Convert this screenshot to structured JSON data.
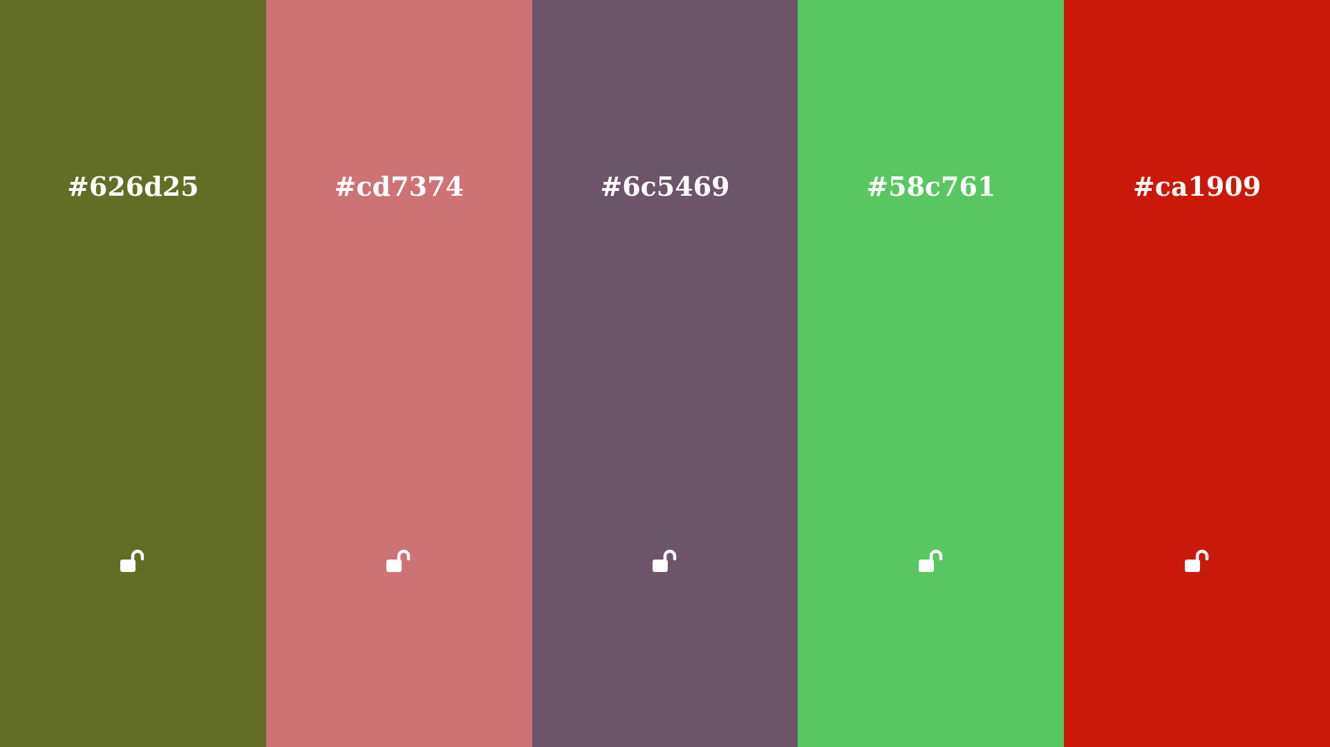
{
  "palette": {
    "colors": [
      {
        "hex": "#626d25",
        "locked": false,
        "lock_icon": "unlocked-padlock-icon"
      },
      {
        "hex": "#cd7374",
        "locked": false,
        "lock_icon": "unlocked-padlock-icon"
      },
      {
        "hex": "#6c5469",
        "locked": false,
        "lock_icon": "unlocked-padlock-icon"
      },
      {
        "hex": "#58c761",
        "locked": false,
        "lock_icon": "unlocked-padlock-icon"
      },
      {
        "hex": "#ca1909",
        "locked": false,
        "lock_icon": "unlocked-padlock-icon"
      }
    ],
    "label_color": "#ffffff"
  }
}
